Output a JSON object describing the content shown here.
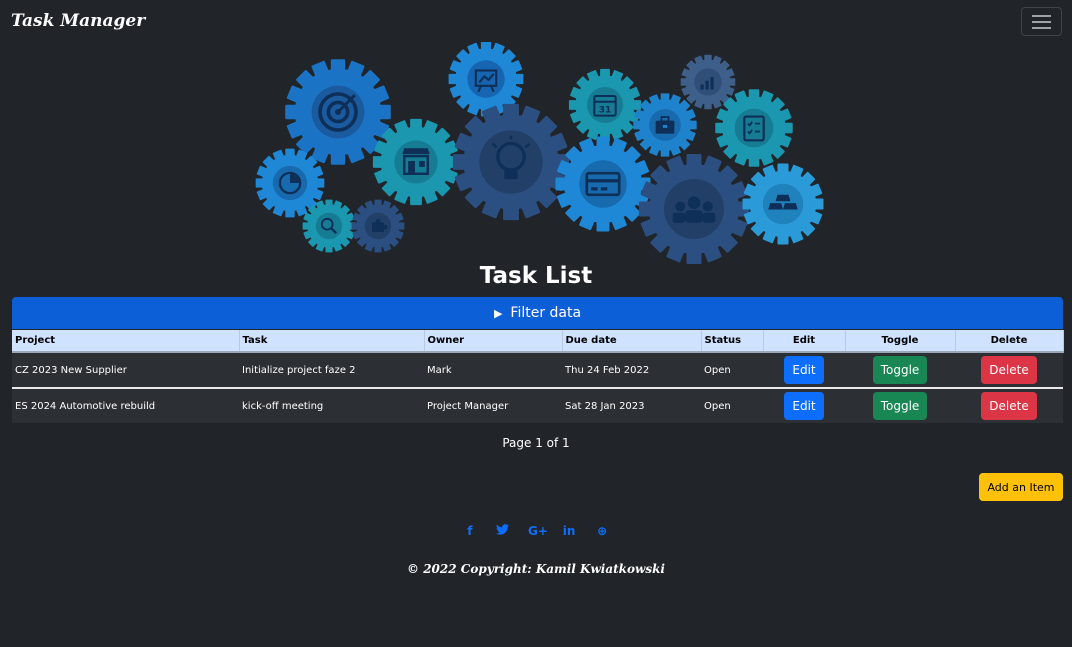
{
  "navbar": {
    "brand": "Task Manager"
  },
  "hero": {
    "icons": [
      "target-icon",
      "chart-board-icon",
      "calendar-icon",
      "analytics-icon",
      "checklist-icon",
      "store-icon",
      "lightbulb-icon",
      "briefcase-icon",
      "pie-chart-icon",
      "credit-card-icon",
      "team-icon",
      "gold-bars-icon",
      "search-icon",
      "puzzle-icon"
    ],
    "colors": {
      "dark_blue": "#1f5aa0",
      "blue": "#1a7fcc",
      "teal": "#1b9ab0",
      "light_blue": "#3aa7d6",
      "navy": "#2b4d7e",
      "slate": "#39597f"
    },
    "calendar_day": "31"
  },
  "page": {
    "title": "Task List"
  },
  "filter": {
    "label": "Filter data",
    "arrow": "▶"
  },
  "table": {
    "headers": {
      "project": "Project",
      "task": "Task",
      "owner": "Owner",
      "due": "Due date",
      "status": "Status",
      "edit": "Edit",
      "toggle": "Toggle",
      "delete": "Delete"
    },
    "rows": [
      {
        "project": "CZ 2023 New Supplier",
        "task": "Initialize project faze 2",
        "owner": "Mark",
        "due": "Thu 24 Feb 2022",
        "status": "Open",
        "edit": "Edit",
        "toggle": "Toggle",
        "delete": "Delete"
      },
      {
        "project": "ES 2024 Automotive rebuild",
        "task": "kick-off meeting",
        "owner": "Project Manager",
        "due": "Sat 28 Jan 2023",
        "status": "Open",
        "edit": "Edit",
        "toggle": "Toggle",
        "delete": "Delete"
      }
    ]
  },
  "pagination": {
    "text": "Page 1 of 1"
  },
  "actions": {
    "add_label": "Add an Item"
  },
  "social": {
    "facebook": "f",
    "twitter": "🐦",
    "google": "G+",
    "linkedin": "in",
    "dribbble": "⊕"
  },
  "footer": {
    "copyright": "© 2022 Copyright: Kamil Kwiatkowski"
  },
  "colors": {
    "background": "#212529",
    "primary": "#0d6efd",
    "filter_bar": "#0d5fd8",
    "success": "#198754",
    "danger": "#dc3545",
    "warning": "#ffc107",
    "table_header": "#cfe2ff"
  }
}
